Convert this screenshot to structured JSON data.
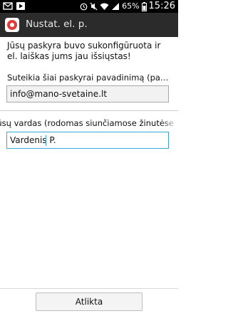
{
  "status_bar": {
    "left_icons": [
      "mail-icon",
      "play-store-icon"
    ],
    "right_icons": [
      "alarm-icon",
      "mute-icon",
      "wifi-icon",
      "signal-icon",
      "battery-icon"
    ],
    "battery": "65%",
    "time": "15:26"
  },
  "action_bar": {
    "title": "Nustat. el. p.",
    "app_icon": "email-app-icon"
  },
  "content": {
    "intro": "Jūsų paskyra buvo sukonfigūruota ir el. laiškas jums jau išsiųstas!",
    "account_name_label": "Suteikia šiai paskyrai pavadinimą (papildo..",
    "account_name_value": "info@mano-svetaine.lt",
    "your_name_label": "Jūsų vardas (rodomas siunčiamose žinutėse",
    "your_name_value": "Vardenis P."
  },
  "buttons": {
    "done": "Atlikta"
  },
  "colors": {
    "status_bar": "#000000",
    "action_bar": "#2b2b2b",
    "focus_accent": "#3aa6d8",
    "app_icon": "#e23a3a"
  }
}
